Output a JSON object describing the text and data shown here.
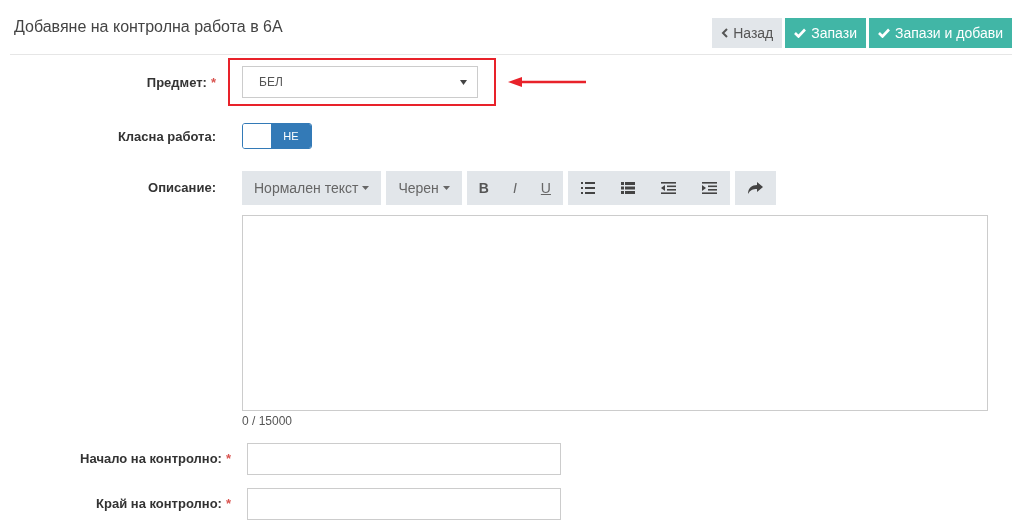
{
  "header": {
    "title": "Добавяне на контролна работа в 6А",
    "buttons": [
      {
        "kind": "back",
        "label": "Назад"
      },
      {
        "kind": "save",
        "label": "Запази"
      },
      {
        "kind": "save",
        "label": "Запази и добави"
      }
    ]
  },
  "subject": {
    "label": "Предмет:",
    "mark": "*",
    "value": "БЕЛ",
    "highlighted": true
  },
  "classwork": {
    "label": "Класна работа:",
    "on": false,
    "state_label": "НЕ"
  },
  "description": {
    "label": "Описание:",
    "toolbar": [
      [
        {
          "kind": "dropdown",
          "label": "Нормален текст"
        }
      ],
      [
        {
          "kind": "dropdown",
          "label": "Черен"
        }
      ],
      [
        {
          "kind": "bold",
          "label": "B"
        },
        {
          "kind": "italic",
          "label": "I"
        },
        {
          "kind": "underline",
          "label": "U"
        }
      ],
      [
        {
          "kind": "bullet-list"
        },
        {
          "kind": "numbered-list"
        },
        {
          "kind": "outdent"
        },
        {
          "kind": "indent"
        }
      ],
      [
        {
          "kind": "redo"
        }
      ]
    ],
    "counter": "0 / 15000"
  },
  "dates": [
    {
      "label": "Начало на контролно:",
      "mark": "*"
    },
    {
      "label": "Край на контролно:",
      "mark": "*"
    }
  ]
}
